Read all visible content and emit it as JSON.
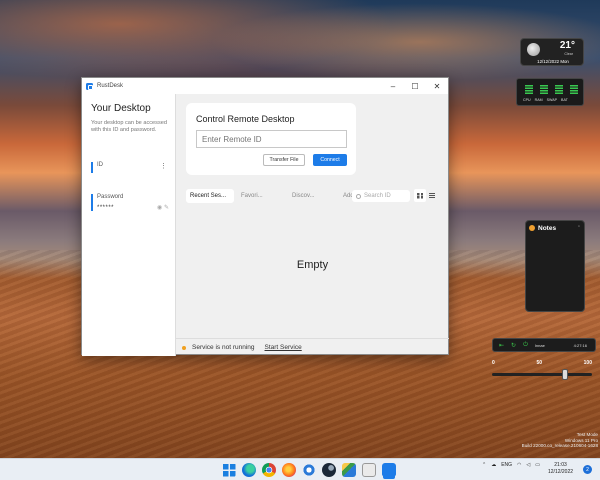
{
  "window": {
    "title": "RustDesk",
    "controls": {
      "minimize": "–",
      "maximize": "☐",
      "close": "✕"
    }
  },
  "sidebar": {
    "title": "Your Desktop",
    "description": "Your desktop can be accessed with this ID and password.",
    "id_label": "ID",
    "id_value": "",
    "password_label": "Password",
    "password_value": "******"
  },
  "control": {
    "title": "Control Remote Desktop",
    "input_placeholder": "Enter Remote ID",
    "transfer_label": "Transfer File",
    "connect_label": "Connect"
  },
  "tabs": [
    "Recent Ses...",
    "Favori...",
    "Discov...",
    "Address ..."
  ],
  "search": {
    "placeholder": "Search ID"
  },
  "empty_label": "Empty",
  "status": {
    "text": "Service is not running",
    "action": "Start Service"
  },
  "widgets": {
    "weather": {
      "temp": "21°",
      "desc": "Clear",
      "date": "12/12/2022 Mon"
    },
    "meter": {
      "labels": [
        "CPU",
        "RAM",
        "SWAP",
        "BAT"
      ]
    },
    "notes": {
      "title": "Notes"
    },
    "player": {
      "title": "Innae",
      "time": "4:27:16"
    },
    "slider": {
      "min": "0",
      "mid": "50",
      "max": "100",
      "value": 70
    }
  },
  "watermark": {
    "line1": "Test Mode",
    "line2": "Windows 11 Pro",
    "line3": "Build 22000.co_release.210604-1628"
  },
  "taskbar": {
    "apps": [
      "start",
      "edge",
      "chrome",
      "firefox-beta",
      "settings",
      "steam",
      "paint",
      "terminal",
      "rustdesk"
    ],
    "lang": "ENG",
    "time": "21:03",
    "date": "12/12/2022",
    "notifications": "2"
  },
  "colors": {
    "accent": "#1d7ce8",
    "status_dot": "#f0a020"
  }
}
